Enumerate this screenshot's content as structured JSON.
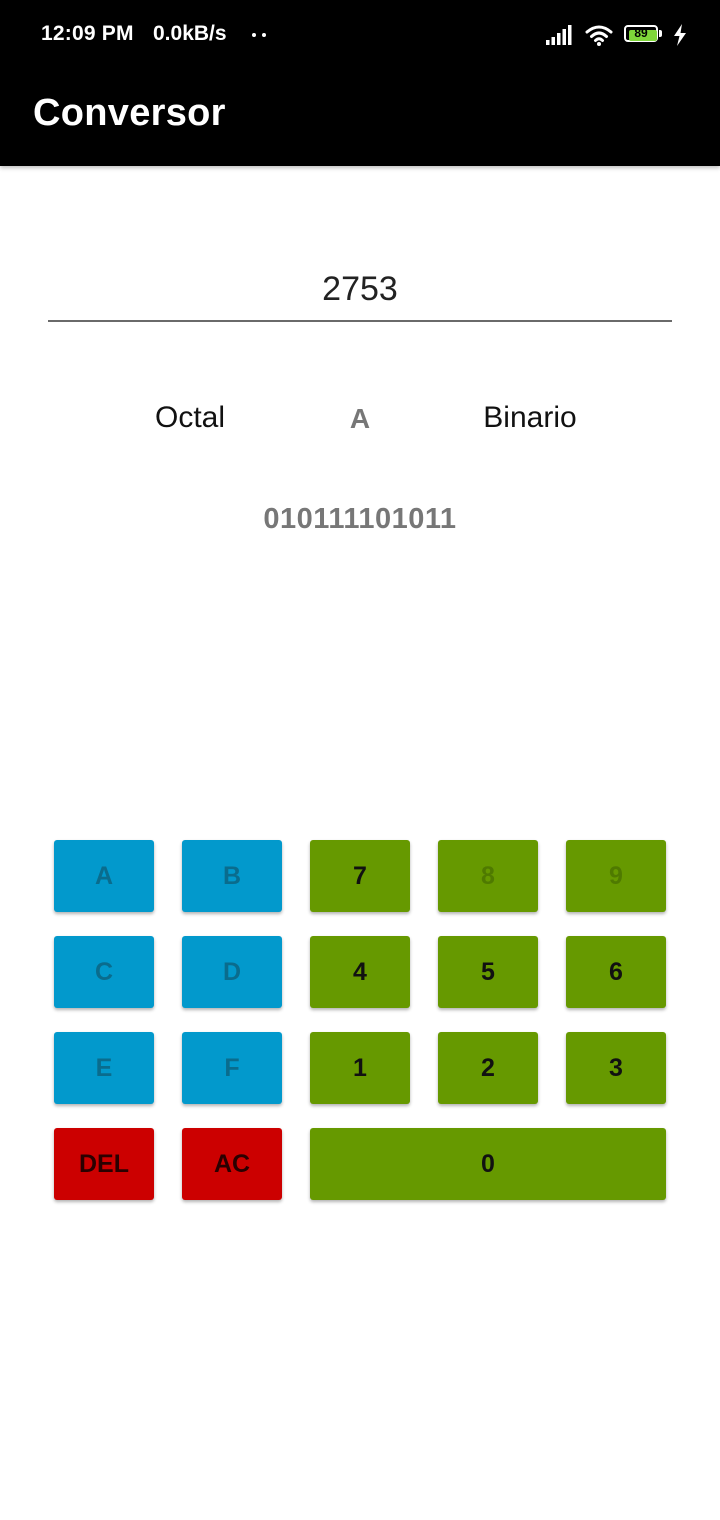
{
  "status_bar": {
    "time": "12:09 PM",
    "speed": "0.0kB/s",
    "battery_level": "89"
  },
  "app_bar": {
    "title": "Conversor"
  },
  "converter": {
    "input_value": "2753",
    "from_base": "Octal",
    "separator": "A",
    "to_base": "Binario",
    "result": "010111101011"
  },
  "keypad": {
    "A": "A",
    "B": "B",
    "C": "C",
    "D": "D",
    "E": "E",
    "F": "F",
    "0": "0",
    "1": "1",
    "2": "2",
    "3": "3",
    "4": "4",
    "5": "5",
    "6": "6",
    "7": "7",
    "8": "8",
    "9": "9",
    "del": "DEL",
    "ac": "AC"
  },
  "colors": {
    "hex_key": "#0299cc",
    "digit_key": "#669900",
    "action_key": "#cc0000",
    "app_bar": "#000000"
  }
}
